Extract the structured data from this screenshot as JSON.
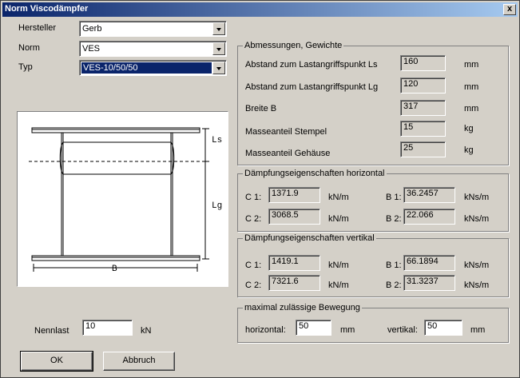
{
  "window": {
    "title": "Norm Viscodämpfer",
    "close_label": "x"
  },
  "left": {
    "hersteller_label": "Hersteller",
    "hersteller_value": "Gerb",
    "norm_label": "Norm",
    "norm_value": "VES",
    "typ_label": "Typ",
    "typ_value": "VES-10/50/50",
    "nennlast_label": "Nennlast",
    "nennlast_value": "10",
    "nennlast_unit": "kN"
  },
  "sketch": {
    "ls": "Ls",
    "lg": "Lg",
    "b": "B"
  },
  "abmessungen": {
    "title": "Abmessungen, Gewichte",
    "rows": [
      {
        "label": "Abstand zum Lastangriffspunkt Ls",
        "value": "160",
        "unit": "mm"
      },
      {
        "label": "Abstand zum Lastangriffspunkt Lg",
        "value": "120",
        "unit": "mm"
      },
      {
        "label": "Breite B",
        "value": "317",
        "unit": "mm"
      },
      {
        "label": "Masseanteil Stempel",
        "value": "15",
        "unit": "kg"
      },
      {
        "label": "Masseanteil Gehäuse",
        "value": "25",
        "unit": "kg"
      }
    ]
  },
  "horizontal": {
    "title": "Dämpfungseigenschaften horizontal",
    "c1_label": "C 1:",
    "c1_value": "1371.9",
    "c1_unit": "kN/m",
    "b1_label": "B 1:",
    "b1_value": "36.2457",
    "b1_unit": "kNs/m",
    "c2_label": "C 2:",
    "c2_value": "3068.5",
    "c2_unit": "kN/m",
    "b2_label": "B 2:",
    "b2_value": "22.066",
    "b2_unit": "kNs/m"
  },
  "vertikal": {
    "title": "Dämpfungseigenschaften vertikal",
    "c1_label": "C 1:",
    "c1_value": "1419.1",
    "c1_unit": "kN/m",
    "b1_label": "B 1:",
    "b1_value": "66.1894",
    "b1_unit": "kNs/m",
    "c2_label": "C 2:",
    "c2_value": "7321.6",
    "c2_unit": "kN/m",
    "b2_label": "B 2:",
    "b2_value": "31.3237",
    "b2_unit": "kNs/m"
  },
  "bewegung": {
    "title": "maximal zulässige Bewegung",
    "horizontal_label": "horizontal:",
    "horizontal_value": "50",
    "horizontal_unit": "mm",
    "vertikal_label": "vertikal:",
    "vertikal_value": "50",
    "vertikal_unit": "mm"
  },
  "buttons": {
    "ok": "OK",
    "abbruch": "Abbruch"
  }
}
